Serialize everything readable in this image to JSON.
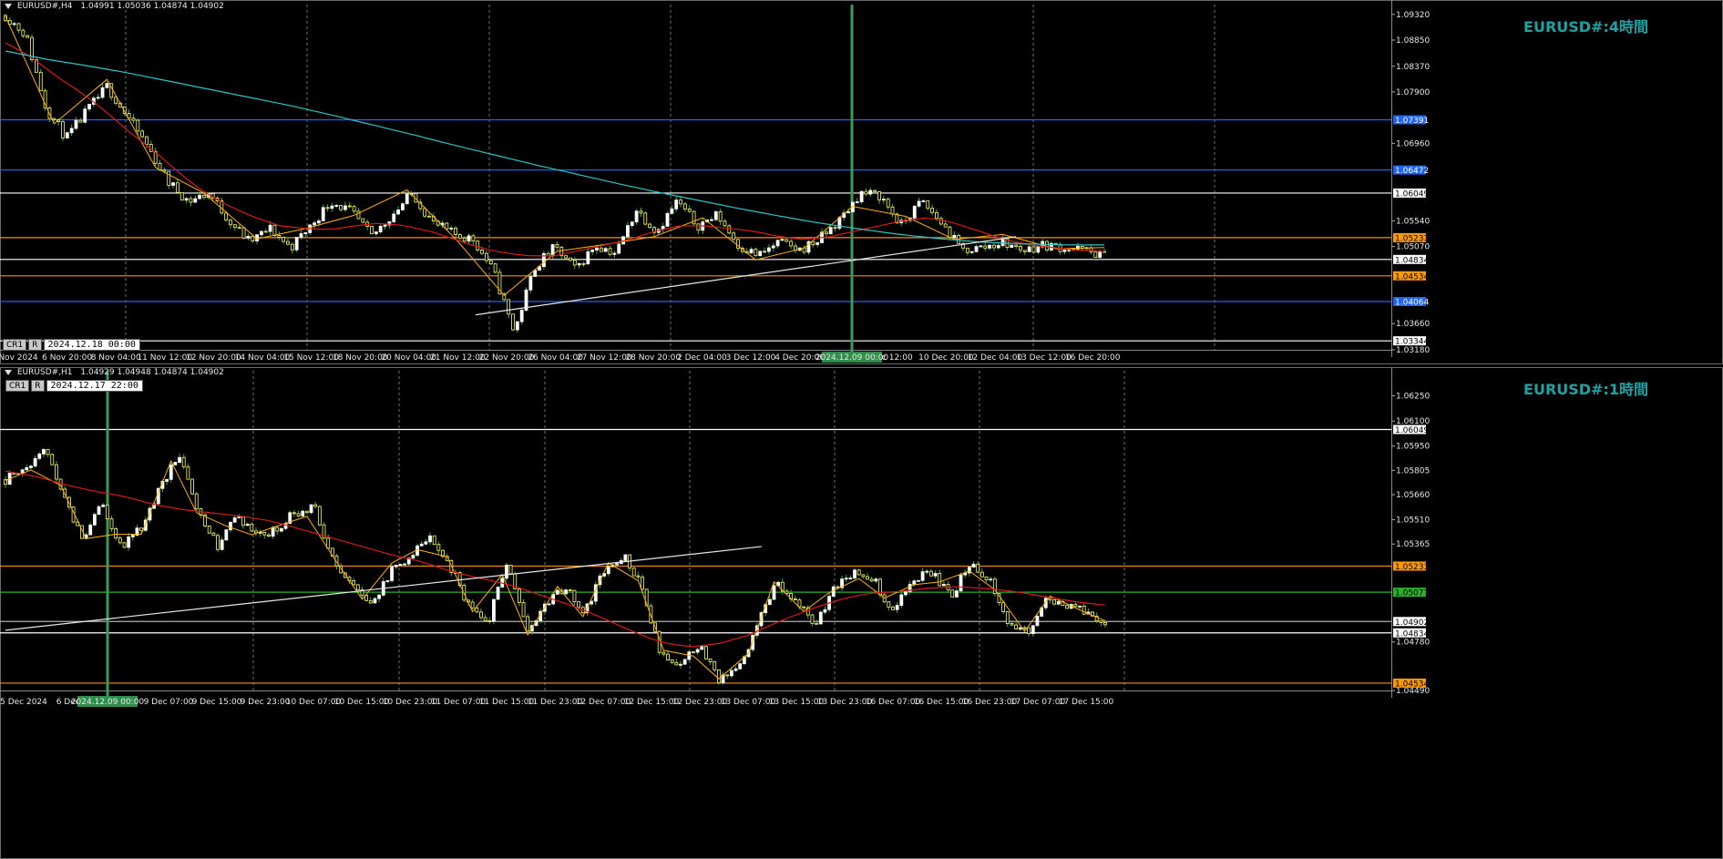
{
  "colors": {
    "background": "#000000",
    "grid": "#8a8a8a",
    "bull": "#ffffff",
    "bear": "#ffff66",
    "wick": "#3cb043",
    "ma_short": "#d91a1a",
    "ma_long": "#2ec4c4",
    "zigzag": "#ffb000",
    "trendline": "#e6e6e6",
    "brand": "#1fa3a3",
    "crosshair": "#3c9a5a"
  },
  "chart_data": [
    {
      "type": "candlestick",
      "symbol": "EURUSD#,H4",
      "ohlc_header": "1.04991 1.05036 1.04874 1.04902",
      "brand_label": "EURUSD#:4時間",
      "cursor_date": "2024.12.18 00:00",
      "crosshair_date": "2024.12.09 00:00",
      "chart_buttons": [
        "CR1",
        "R"
      ],
      "ylim": [
        1.0318,
        1.095
      ],
      "y_ticks": [
        1.0932,
        1.0885,
        1.0837,
        1.079,
        1.0696,
        1.0554,
        1.0507,
        1.0366,
        1.0318
      ],
      "x_ticks": [
        "Nov 2024",
        "6 Nov 20:00",
        "8 Nov 04:00",
        "11 Nov 12:00",
        "12 Nov 20:00",
        "14 Nov 04:00",
        "15 Nov 12:00",
        "18 Nov 20:00",
        "20 Nov 04:00",
        "21 Nov 12:00",
        "22 Nov 20:00",
        "26 Nov 04:00",
        "27 Nov 12:00",
        "28 Nov 20:00",
        "2 Dec 04:00",
        "3 Dec 12:00",
        "4 Dec 20:00",
        "",
        "c 12:00",
        "10 Dec 20:00",
        "12 Dec 04:00",
        "13 Dec 12:00",
        "16 Dec 20:00"
      ],
      "levels": [
        {
          "price": 1.07391,
          "color": "#1e64ff",
          "label_bg": "#1e64ff",
          "label_fg": "#ffffff",
          "label": "1.07391"
        },
        {
          "price": 1.06472,
          "color": "#1e64ff",
          "label_bg": "#1e64ff",
          "label_fg": "#ffffff",
          "label": "1.06472"
        },
        {
          "price": 1.06049,
          "color": "#ffffff",
          "label_bg": "#ffffff",
          "label_fg": "#000000",
          "label": "1.06049"
        },
        {
          "price": 1.05233,
          "color": "#ff8c00",
          "label_bg": "#ff9900",
          "label_fg": "#000000",
          "label": "1.05233"
        },
        {
          "price": 1.04834,
          "color": "#ffffff",
          "label_bg": "#ffffff",
          "label_fg": "#000000",
          "label": "1.04834"
        },
        {
          "price": 1.04534,
          "color": "#ff8c00",
          "label_bg": "#ff9900",
          "label_fg": "#000000",
          "label": "1.04534"
        },
        {
          "price": 1.04064,
          "color": "#1e64ff",
          "label_bg": "#1e64ff",
          "label_fg": "#ffffff",
          "label": "1.04064"
        },
        {
          "price": 1.03344,
          "color": "#ffffff",
          "label_bg": "#ffffff",
          "label_fg": "#000000",
          "label": "1.03344"
        }
      ],
      "close_path": [
        1.093,
        1.0895,
        1.076,
        1.0705,
        1.0755,
        1.08,
        1.0745,
        1.069,
        1.0625,
        1.059,
        1.0605,
        1.0555,
        1.0515,
        1.054,
        1.0505,
        1.0545,
        1.059,
        1.057,
        1.0525,
        1.0565,
        1.0605,
        1.055,
        1.053,
        1.052,
        1.046,
        1.035,
        1.047,
        1.0505,
        1.0465,
        1.051,
        1.0495,
        1.0575,
        1.0535,
        1.059,
        1.0545,
        1.0565,
        1.051,
        1.049,
        1.0515,
        1.05,
        1.052,
        1.0555,
        1.0605,
        1.06,
        1.0545,
        1.059,
        1.055,
        1.05,
        1.0505,
        1.0515,
        1.05,
        1.051,
        1.0505,
        1.05,
        1.049
      ],
      "ma_short": [
        1.088,
        1.0855,
        1.082,
        1.079,
        1.0755,
        1.0715,
        1.068,
        1.064,
        1.0605,
        1.058,
        1.056,
        1.0545,
        1.054,
        1.0538,
        1.0545,
        1.055,
        1.0545,
        1.0535,
        1.052,
        1.0505,
        1.0495,
        1.049,
        1.049,
        1.05,
        1.051,
        1.052,
        1.0535,
        1.0545,
        1.0545,
        1.054,
        1.0535,
        1.0525,
        1.052,
        1.0525,
        1.0535,
        1.0545,
        1.0555,
        1.056,
        1.055,
        1.0535,
        1.052,
        1.051,
        1.0505,
        1.05,
        1.0498
      ],
      "ma_long": [
        1.0865,
        1.085,
        1.0838,
        1.0825,
        1.081,
        1.0795,
        1.078,
        1.0765,
        1.0748,
        1.073,
        1.0712,
        1.0693,
        1.0675,
        1.0657,
        1.064,
        1.0623,
        1.0607,
        1.0592,
        1.0577,
        1.0563,
        1.055,
        1.0539,
        1.0529,
        1.0521,
        1.0515,
        1.0512,
        1.051,
        1.051
      ],
      "trendline": [
        [
          1.0382,
          0.0
        ],
        [
          1.0525,
          1.0
        ]
      ]
    },
    {
      "type": "candlestick",
      "symbol": "EURUSD#,H1",
      "ohlc_header": "1.04929 1.04948 1.04874 1.04902",
      "brand_label": "EURUSD#:1時間",
      "cursor_date": "2024.12.17 22:00",
      "crosshair_date": "2024.12.09 00:00",
      "chart_buttons": [
        "CR1",
        "R"
      ],
      "ylim": [
        1.0449,
        1.064
      ],
      "y_ticks": [
        1.0625,
        1.061,
        1.0595,
        1.05805,
        1.0566,
        1.0551,
        1.05365,
        1.0478,
        1.0449
      ],
      "x_ticks": [
        "5 Dec 2024",
        "6 Dec 1",
        "",
        "9 Dec 07:00",
        "9 Dec 15:00",
        "9 Dec 23:00",
        "10 Dec 07:00",
        "10 Dec 15:00",
        "10 Dec 23:00",
        "11 Dec 07:00",
        "11 Dec 15:00",
        "11 Dec 23:00",
        "12 Dec 07:00",
        "12 Dec 15:00",
        "12 Dec 23:00",
        "13 Dec 07:00",
        "13 Dec 15:00",
        "13 Dec 23:00",
        "16 Dec 07:00",
        "16 Dec 15:00",
        "16 Dec 23:00",
        "17 Dec 07:00",
        "17 Dec 15:00"
      ],
      "levels": [
        {
          "price": 1.06049,
          "color": "#ffffff",
          "label_bg": "#ffffff",
          "label_fg": "#000000",
          "label": "1.06049"
        },
        {
          "price": 1.05233,
          "color": "#ff8c00",
          "label_bg": "#ff9900",
          "label_fg": "#000000",
          "label": "1.05233"
        },
        {
          "price": 1.05077,
          "color": "#2bb12b",
          "label_bg": "#2bb12b",
          "label_fg": "#000000",
          "label": "1.05077"
        },
        {
          "price": 1.04902,
          "color": "#b0b0b0",
          "label_bg": "#ffffff",
          "label_fg": "#000000",
          "label": "1.04902"
        },
        {
          "price": 1.04834,
          "color": "#ffffff",
          "label_bg": "#ffffff",
          "label_fg": "#000000",
          "label": "1.04834"
        },
        {
          "price": 1.04534,
          "color": "#ff8c00",
          "label_bg": "#ff9900",
          "label_fg": "#000000",
          "label": "1.04534"
        }
      ],
      "close_path": [
        1.0575,
        1.058,
        1.0595,
        1.0565,
        1.054,
        1.056,
        1.0535,
        1.0545,
        1.057,
        1.059,
        1.0555,
        1.0535,
        1.0555,
        1.054,
        1.0545,
        1.0555,
        1.056,
        1.0525,
        1.051,
        1.05,
        1.052,
        1.053,
        1.054,
        1.0525,
        1.05,
        1.049,
        1.0525,
        1.0485,
        1.05,
        1.051,
        1.0495,
        1.052,
        1.053,
        1.051,
        1.047,
        1.0465,
        1.0475,
        1.0455,
        1.046,
        1.049,
        1.0515,
        1.05,
        1.049,
        1.051,
        1.052,
        1.0515,
        1.0495,
        1.0515,
        1.052,
        1.0505,
        1.0525,
        1.0515,
        1.049,
        1.0485,
        1.0505,
        1.05,
        1.0495,
        1.049
      ],
      "ma_short": [
        1.058,
        1.0577,
        1.0572,
        1.0568,
        1.0565,
        1.056,
        1.0557,
        1.0555,
        1.0553,
        1.055,
        1.0545,
        1.054,
        1.0535,
        1.053,
        1.0526,
        1.052,
        1.0516,
        1.0512,
        1.0506,
        1.05,
        1.0493,
        1.0485,
        1.0478,
        1.0475,
        1.0477,
        1.0482,
        1.049,
        1.0497,
        1.0503,
        1.0507,
        1.0508,
        1.051,
        1.0511,
        1.051,
        1.0508,
        1.0505,
        1.0502,
        1.05
      ],
      "trendline": [
        [
          1.0485,
          0.0
        ],
        [
          1.0535,
          1.0
        ]
      ]
    }
  ]
}
